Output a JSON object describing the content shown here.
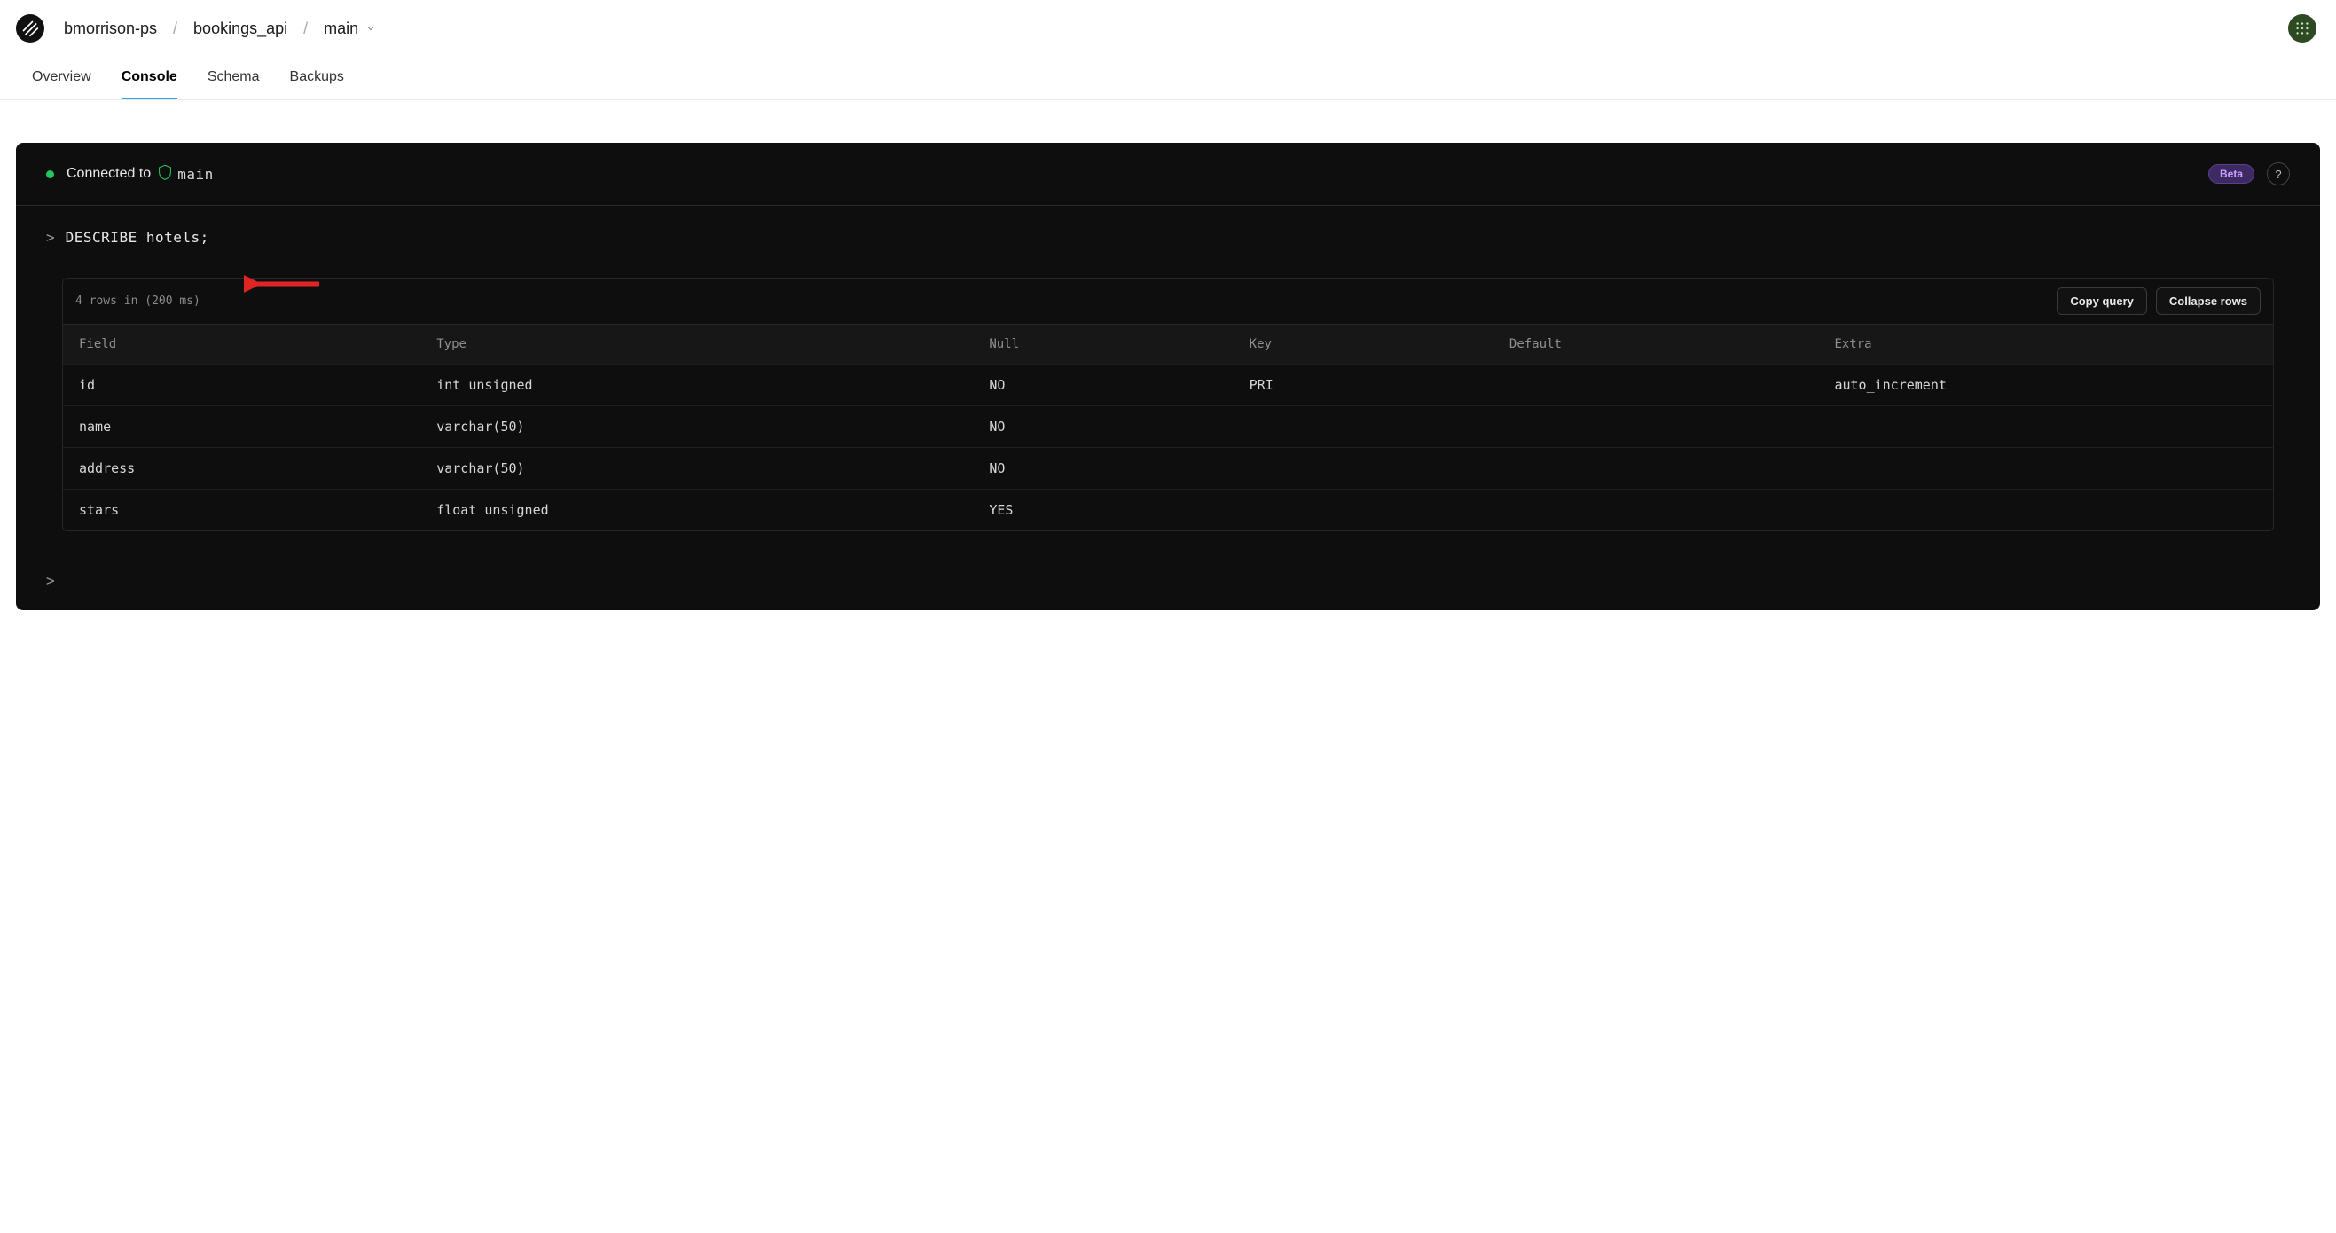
{
  "breadcrumb": {
    "org": "bmorrison-ps",
    "db": "bookings_api",
    "branch": "main"
  },
  "tabs": [
    {
      "label": "Overview",
      "active": false
    },
    {
      "label": "Console",
      "active": true
    },
    {
      "label": "Schema",
      "active": false
    },
    {
      "label": "Backups",
      "active": false
    }
  ],
  "console": {
    "connected_label": "Connected to",
    "branch": "main",
    "beta_label": "Beta",
    "query": "DESCRIBE hotels;",
    "result_meta": "4 rows in (200 ms)",
    "copy_label": "Copy query",
    "collapse_label": "Collapse rows",
    "columns": [
      "Field",
      "Type",
      "Null",
      "Key",
      "Default",
      "Extra"
    ],
    "rows": [
      {
        "Field": "id",
        "Type": "int unsigned",
        "Null": "NO",
        "Key": "PRI",
        "Default": "",
        "Extra": "auto_increment"
      },
      {
        "Field": "name",
        "Type": "varchar(50)",
        "Null": "NO",
        "Key": "",
        "Default": "",
        "Extra": ""
      },
      {
        "Field": "address",
        "Type": "varchar(50)",
        "Null": "NO",
        "Key": "",
        "Default": "",
        "Extra": ""
      },
      {
        "Field": "stars",
        "Type": "float unsigned",
        "Null": "YES",
        "Key": "",
        "Default": "",
        "Extra": ""
      }
    ]
  },
  "annotation": {
    "color": "#e02424"
  }
}
